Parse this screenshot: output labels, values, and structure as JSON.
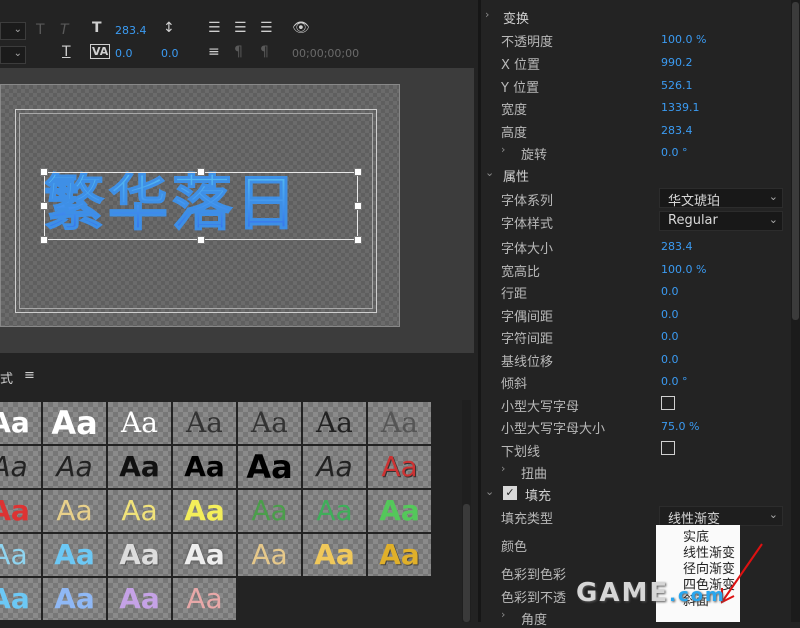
{
  "toolbar": {
    "font_size_value": "283.4",
    "tracking_value": "0.0",
    "kerning_value": "0.0",
    "timecode": "00;00;00;00"
  },
  "preview": {
    "title_text": "繁华落日"
  },
  "styles_panel": {
    "title": "式",
    "tiles": [
      [
        "Aa",
        "Aa",
        "Aa",
        "Aa",
        "Aa",
        "Aa",
        "Aa"
      ],
      [
        "Aa",
        "Aa",
        "Aa",
        "Aa",
        "Aa",
        "Aa",
        "Aa"
      ],
      [
        "Aa",
        "Aa",
        "Aa",
        "Aa",
        "Aa",
        "Aa",
        "Aa"
      ],
      [
        "Aa",
        "Aa",
        "Aa",
        "Aa",
        "Aa",
        "Aa",
        "Aa"
      ],
      [
        "Aa",
        "Aa",
        "Aa",
        "Aa"
      ]
    ]
  },
  "properties": {
    "transform_header": "变换",
    "opacity_label": "不透明度",
    "opacity_value": "100.0 %",
    "x_label": "X 位置",
    "x_value": "990.2",
    "y_label": "Y 位置",
    "y_value": "526.1",
    "width_label": "宽度",
    "width_value": "1339.1",
    "height_label": "高度",
    "height_value": "283.4",
    "rotation_label": "旋转",
    "rotation_value": "0.0 °",
    "attributes_header": "属性",
    "font_family_label": "字体系列",
    "font_family_value": "华文琥珀",
    "font_style_label": "字体样式",
    "font_style_value": "Regular",
    "font_size_label": "字体大小",
    "font_size_value": "283.4",
    "aspect_label": "宽高比",
    "aspect_value": "100.0 %",
    "leading_label": "行距",
    "leading_value": "0.0",
    "kerning_label": "字偶间距",
    "kerning_value": "0.0",
    "tracking_label": "字符间距",
    "tracking_value": "0.0",
    "baseline_label": "基线位移",
    "baseline_value": "0.0",
    "slant_label": "倾斜",
    "slant_value": "0.0 °",
    "smallcaps_label": "小型大写字母",
    "smallcaps_size_label": "小型大写字母大小",
    "smallcaps_size_value": "75.0 %",
    "underline_label": "下划线",
    "distort_label": "扭曲",
    "fill_header": "填充",
    "fill_type_label": "填充类型",
    "fill_type_value": "线性渐变",
    "color_label": "颜色",
    "color_to_color_label": "色彩到色彩",
    "color_to_opacity_label": "色彩到不透",
    "angle_label": "角度"
  },
  "fill_type_menu": {
    "items": [
      "实底",
      "线性渐变",
      "径向渐变",
      "四色渐变",
      "斜面"
    ]
  },
  "watermark": {
    "text": "GAME",
    "suffix": ".com"
  },
  "colors": {
    "accent": "#3b9bf2",
    "background": "#232323"
  }
}
